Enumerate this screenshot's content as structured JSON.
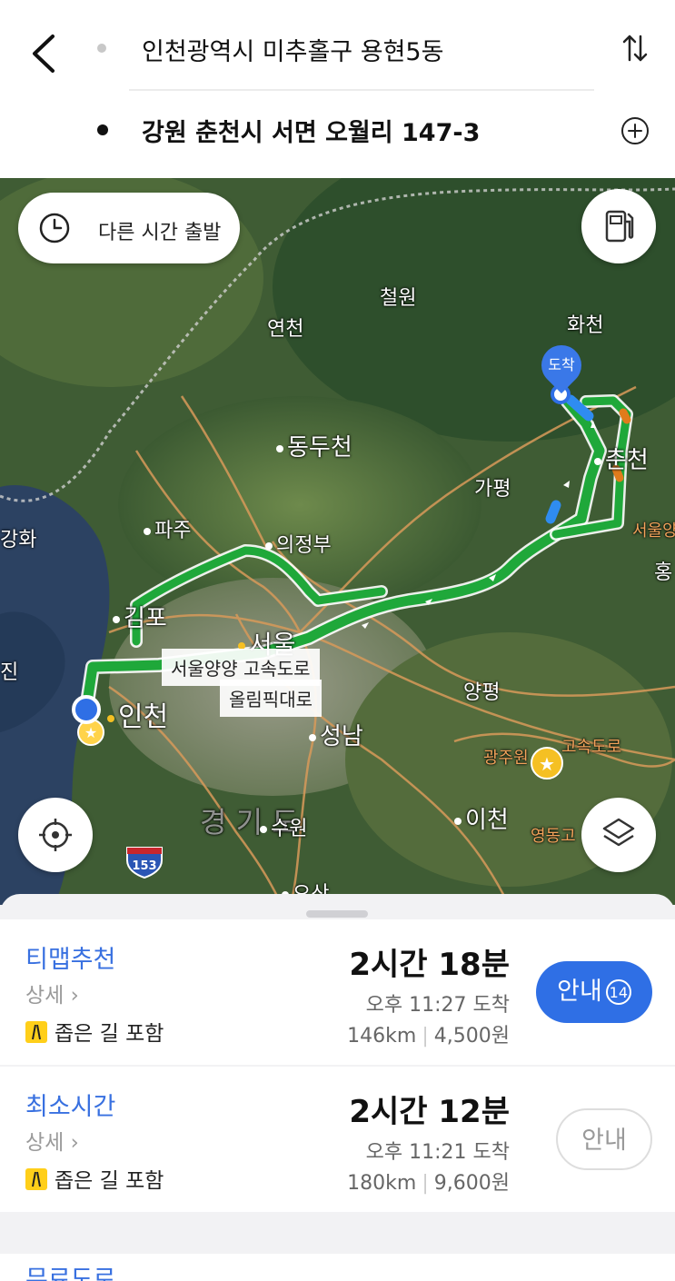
{
  "header": {
    "origin": "인천광역시 미추홀구 용현5동",
    "destination": "강원 춘천시 서면 오월리 147-3"
  },
  "map": {
    "depart_other_time": "다른 시간 출발",
    "destination_pin": "도착",
    "labels": {
      "cheorwon": "철원",
      "yeoncheon": "연천",
      "hwacheon": "화천",
      "dongducheon": "동두천",
      "chuncheon": "춘천",
      "gapyeong": "가평",
      "ganghwa": "강화",
      "paju": "파주",
      "uijeongbu": "의정부",
      "seoulyang_edge": "서울양",
      "hong_edge": "홍",
      "gimpo": "김포",
      "seoul": "서울",
      "incheon": "인천",
      "jin_edge": "진",
      "yangpyeong": "양평",
      "seongnam": "성남",
      "gwangju_won": "광주원",
      "gosokdoro": "고속도로",
      "gyeonggido": "경 기 도",
      "suwon": "수원",
      "icheon": "이천",
      "yeongdong": "영동고",
      "osan": "오산",
      "highway_shield": "153"
    },
    "route_tags": [
      "서울양양 고속도로",
      "올림픽대로"
    ],
    "colors": {
      "route": "#1fa83a",
      "route_blue": "#2f8cf0",
      "route_orange": "#e07b1c"
    }
  },
  "routes": [
    {
      "name": "티맵추천",
      "detail": "상세",
      "warning": "좁은 길 포함",
      "duration": "2시간 18분",
      "arrival": "오후 11:27 도착",
      "distance": "146km",
      "toll": "4,500원",
      "button": "안내",
      "badge": "14"
    },
    {
      "name": "최소시간",
      "detail": "상세",
      "warning": "좁은 길 포함",
      "duration": "2시간 12분",
      "arrival": "오후 11:21 도착",
      "distance": "180km",
      "toll": "9,600원",
      "button": "안내"
    }
  ],
  "peek_title": "무료도로"
}
